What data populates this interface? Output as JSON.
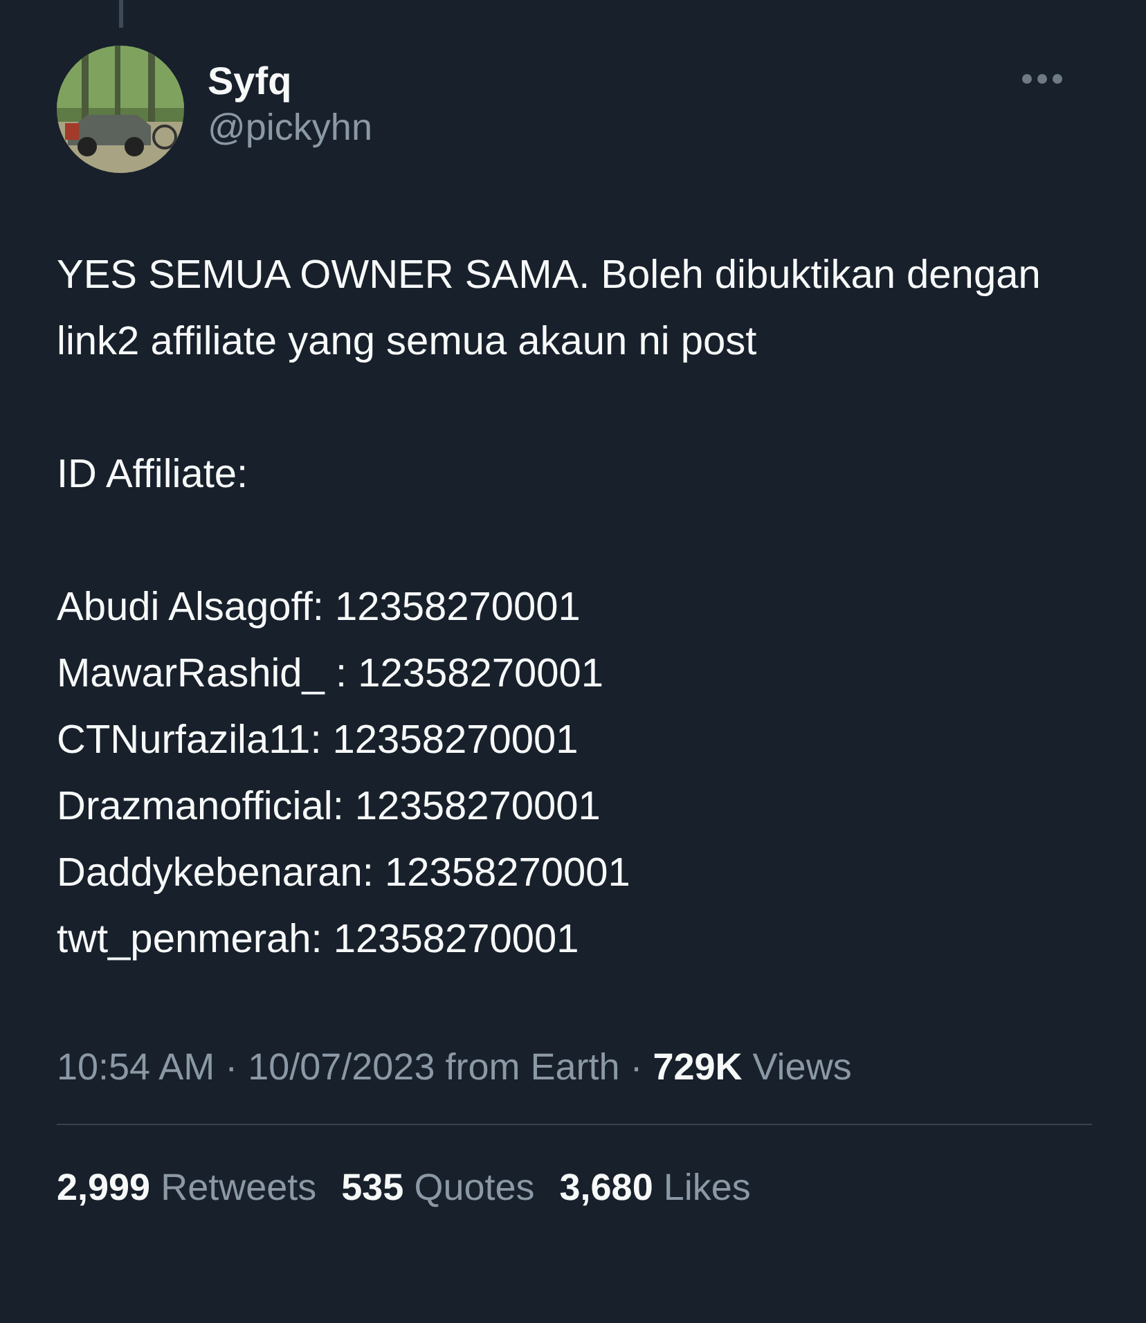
{
  "author": {
    "name": "Syfq",
    "handle": "@pickyhn"
  },
  "paragraphs": [
    "YES SEMUA OWNER SAMA. Boleh dibuktikan dengan link2 affiliate yang semua akaun ni post",
    "ID Affiliate:"
  ],
  "affiliate_lines": [
    "Abudi Alsagoff: 12358270001",
    "MawarRashid_ : 12358270001",
    "CTNurfazila11: 12358270001",
    "Drazmanofficial: 12358270001",
    "Daddykebenaran: 12358270001",
    "twt_penmerah: 12358270001"
  ],
  "meta": "10:54 AM · 10/07/2023 from Earth · **729K** Views",
  "stats": [
    "**2,999** Retweets",
    "**535** Quotes",
    "**3,680** Likes"
  ]
}
